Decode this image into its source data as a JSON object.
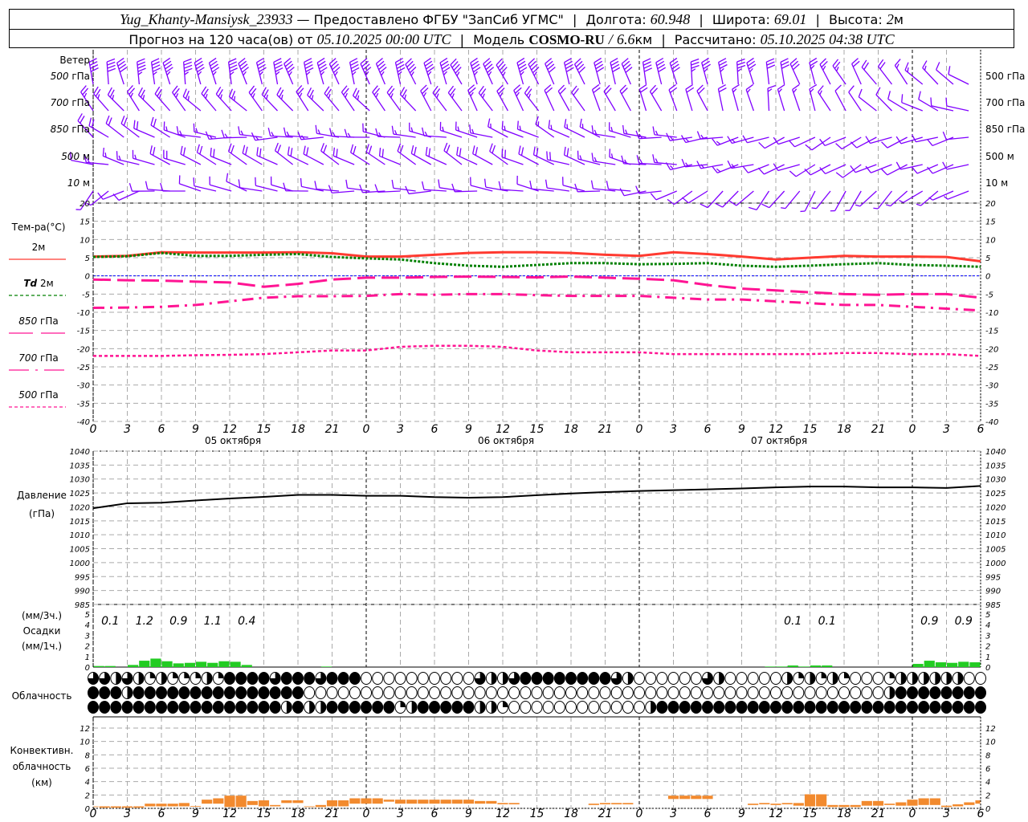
{
  "header": {
    "station": "Yug_Khanty-Mansiysk_23933",
    "dash": "—",
    "provider": "Предоставлено ФГБУ \"ЗапСиб УГМС\"",
    "lon_label": "Долгота:",
    "lon": "60.948",
    "lat_label": "Широта:",
    "lat": "69.01",
    "alt_label": "Высота:",
    "alt": "2",
    "alt_unit": "м",
    "forecast_label": "Прогноз на 120 часа(ов) от",
    "forecast_time": "05.10.2025 00:00 UTC",
    "model_label": "Модель",
    "model": "COSMO-RU",
    "slash": "/",
    "resolution": "6.6",
    "res_unit": "км",
    "calc_label": "Рассчитано:",
    "calc_time": "05.10.2025 04:38 UTC",
    "sep": "|"
  },
  "colors": {
    "wind": "#8000ff",
    "t2m": "#ff3a30",
    "td2m": "#008000",
    "t850": "#ff1493",
    "t700": "#ff1493",
    "t500": "#ff1493",
    "zero_line": "#0000ff",
    "pressure": "#000000",
    "precip": "#22cc22",
    "convective": "#f28a2e",
    "grid": "#aaaaaa"
  },
  "x_axis": {
    "hours": [
      0,
      3,
      6,
      9,
      12,
      15,
      18,
      21,
      0,
      3,
      6,
      9,
      12,
      15,
      18,
      21,
      0,
      3,
      6,
      9,
      12,
      15,
      18,
      21,
      0,
      3,
      6
    ],
    "dates": [
      "05 октября",
      "06 октября",
      "07 октября"
    ]
  },
  "chart_data": [
    {
      "type": "barbs",
      "panel": "wind",
      "title": "Ветер",
      "levels": [
        {
          "name": "500 гПа",
          "dir_deg": [
            350,
            350,
            345,
            345,
            340,
            340,
            335,
            340,
            345,
            350,
            350,
            330,
            320,
            300
          ],
          "speed_ms": [
            20,
            22,
            22,
            23,
            23,
            22,
            22,
            21,
            20,
            18,
            16,
            12,
            8,
            5
          ]
        },
        {
          "name": "700 гПа",
          "dir_deg": [
            320,
            320,
            315,
            320,
            320,
            325,
            330,
            330,
            335,
            340,
            350,
            330,
            300,
            280
          ],
          "speed_ms": [
            12,
            12,
            12,
            13,
            13,
            13,
            12,
            11,
            10,
            9,
            8,
            6,
            5,
            5
          ]
        },
        {
          "name": "850 гПа",
          "dir_deg": [
            310,
            300,
            270,
            270,
            275,
            280,
            290,
            300,
            280,
            260,
            250,
            240,
            250,
            260
          ],
          "speed_ms": [
            9,
            9,
            8,
            8,
            8,
            8,
            8,
            8,
            8,
            7,
            6,
            6,
            6,
            6
          ]
        },
        {
          "name": "500 м",
          "dir_deg": [
            280,
            290,
            300,
            300,
            300,
            300,
            300,
            290,
            280,
            260,
            250,
            240,
            250,
            250
          ],
          "speed_ms": [
            6,
            9,
            10,
            10,
            10,
            10,
            9,
            9,
            8,
            7,
            6,
            6,
            5,
            5
          ]
        },
        {
          "name": "10 м",
          "dir_deg": [
            220,
            270,
            290,
            280,
            270,
            270,
            280,
            280,
            270,
            230,
            220,
            210,
            230,
            250
          ],
          "speed_ms": [
            3,
            5,
            6,
            5,
            5,
            5,
            5,
            5,
            5,
            4,
            4,
            3,
            3,
            3
          ]
        }
      ],
      "x_step_hours": 6
    },
    {
      "type": "line",
      "panel": "temperature",
      "ylabel": "Тем-ра(°C)",
      "ylim": [
        -40,
        20
      ],
      "yticks": [
        20,
        15,
        10,
        5,
        0,
        -5,
        -10,
        -15,
        -20,
        -25,
        -30,
        -35,
        -40
      ],
      "x_step_hours": 3,
      "series": [
        {
          "name": "2м",
          "values": [
            5.3,
            5.5,
            6.5,
            6.4,
            6.4,
            6.4,
            6.5,
            6.2,
            5.3,
            5.3,
            5.8,
            6.3,
            6.5,
            6.5,
            6.3,
            5.8,
            5.5,
            6.5,
            6.0,
            5.3,
            4.5,
            5.0,
            5.5,
            5.3,
            5.3,
            5.2,
            4.0
          ]
        },
        {
          "name": "Td",
          "name2": "2м",
          "values": [
            5.2,
            5.4,
            6.3,
            5.5,
            5.5,
            5.8,
            6.0,
            5.2,
            4.8,
            4.5,
            3.5,
            2.8,
            2.5,
            3.0,
            3.5,
            3.5,
            3.2,
            3.3,
            3.5,
            2.8,
            2.5,
            2.8,
            3.2,
            3.5,
            3.0,
            2.8,
            2.5
          ]
        },
        {
          "name": "850",
          "name2": "гПа",
          "values": [
            -1,
            -1.2,
            -1.3,
            -1.6,
            -1.8,
            -3,
            -2.2,
            -1,
            -0.5,
            -0.5,
            -0.3,
            -0.2,
            -0.3,
            -0.4,
            -0.2,
            -0.5,
            -0.8,
            -1.2,
            -2.5,
            -3.5,
            -4,
            -4.5,
            -5,
            -5.2,
            -5,
            -5,
            -6
          ]
        },
        {
          "name": "700",
          "name2": "гПа",
          "values": [
            -8.8,
            -8.7,
            -8.5,
            -8,
            -7,
            -6,
            -5.6,
            -5.6,
            -5.5,
            -5.0,
            -5.2,
            -5.0,
            -5.0,
            -5.3,
            -5.5,
            -5.5,
            -5.5,
            -6.0,
            -6.5,
            -6.5,
            -7.0,
            -7.5,
            -8.0,
            -8.0,
            -8.5,
            -9.0,
            -9.5
          ]
        },
        {
          "name": "500",
          "name2": "гПа",
          "values": [
            -22,
            -22,
            -22,
            -21.8,
            -21.7,
            -21.5,
            -21,
            -20.5,
            -20.5,
            -19.5,
            -19.2,
            -19.2,
            -19.5,
            -20.5,
            -21,
            -21,
            -21,
            -21.5,
            -21.5,
            -21.5,
            -21.5,
            -21.5,
            -21.2,
            -21.2,
            -21.5,
            -21.5,
            -22
          ]
        }
      ]
    },
    {
      "type": "line",
      "panel": "pressure",
      "ylabel": "Давление",
      "yunit": "(гПа)",
      "ylim": [
        985,
        1040
      ],
      "yticks": [
        1040,
        1035,
        1030,
        1025,
        1020,
        1015,
        1010,
        1005,
        1000,
        995,
        990,
        985
      ],
      "x_step_hours": 3,
      "values": [
        1019.5,
        1021.3,
        1021.5,
        1022.3,
        1023,
        1023.6,
        1024.3,
        1024.3,
        1024,
        1024,
        1023.5,
        1023.3,
        1023.5,
        1024.2,
        1024.8,
        1025.3,
        1025.7,
        1026,
        1026.3,
        1026.6,
        1027,
        1027.3,
        1027.3,
        1027,
        1027,
        1026.8,
        1027.5
      ]
    },
    {
      "type": "bar",
      "panel": "precipitation",
      "ylabel": "Осадки",
      "yunit_top": "(мм/3ч.)",
      "yunit_bottom": "(мм/1ч.)",
      "ylim": [
        0,
        5
      ],
      "yticks": [
        5,
        4,
        3,
        2,
        1,
        0
      ],
      "x_step_hours": 1,
      "hourly_mm": [
        0.1,
        0.1,
        0,
        0.2,
        0.6,
        0.8,
        0.55,
        0.35,
        0.4,
        0.5,
        0.4,
        0.55,
        0.5,
        0.2,
        0,
        0,
        0,
        0,
        0,
        0,
        0.05,
        0,
        0,
        0,
        0,
        0,
        0,
        0,
        0,
        0,
        0,
        0,
        0,
        0,
        0,
        0,
        0,
        0,
        0,
        0,
        0,
        0,
        0,
        0,
        0,
        0,
        0,
        0,
        0,
        0,
        0,
        0,
        0,
        0,
        0,
        0,
        0,
        0,
        0,
        0.05,
        0.05,
        0.15,
        0.05,
        0.15,
        0.15,
        0,
        0,
        0,
        0,
        0,
        0,
        0,
        0.3,
        0.6,
        0.45,
        0.4,
        0.5,
        0.45
      ],
      "three_hour_labels": [
        {
          "hour": 1.5,
          "text": "0.1"
        },
        {
          "hour": 4.5,
          "text": "1.2"
        },
        {
          "hour": 7.5,
          "text": "0.9"
        },
        {
          "hour": 10.5,
          "text": "1.1"
        },
        {
          "hour": 13.5,
          "text": "0.4"
        },
        {
          "hour": 61.5,
          "text": "0.1"
        },
        {
          "hour": 64.5,
          "text": "0.1"
        },
        {
          "hour": 73.5,
          "text": "0.9"
        },
        {
          "hour": 76.5,
          "text": "0.9"
        }
      ]
    },
    {
      "type": "symbols",
      "panel": "cloudiness",
      "label": "Облачность",
      "encoding": "quarters filled 0-4 per hour",
      "rows": [
        "3323212111214444344434440000000000322344444444320000003200000212121000122222200",
        "4442444444444444444000000000000000000000000000000000000000000000000000244444444",
        "4444444444444444424224444441244444221000000000000244444444444444444444444444444"
      ]
    },
    {
      "type": "bar",
      "panel": "convective",
      "ylabel": "Конвективн.",
      "ylabel2": "облачность",
      "yunit": "(км)",
      "ylim": [
        0,
        13.7
      ],
      "yticks": [
        12,
        10,
        8,
        6,
        4,
        2,
        0
      ],
      "x_step_hours": 1,
      "base_top_km": [
        [
          0.2,
          0.3
        ],
        [
          0.1,
          0.3
        ],
        [
          0.1,
          0.3
        ],
        [
          0.1,
          0.3
        ],
        [
          0.1,
          0.3
        ],
        [
          0.3,
          0.7
        ],
        [
          0.3,
          0.7
        ],
        [
          0.3,
          0.7
        ],
        [
          0.3,
          0.8
        ],
        [
          0.25,
          0.35
        ],
        [
          0.7,
          1.3
        ],
        [
          0.7,
          1.5
        ],
        [
          0.2,
          1.9
        ],
        [
          0.2,
          1.9
        ],
        [
          0.5,
          1.1
        ],
        [
          0.3,
          1.2
        ],
        [
          0.3,
          0.5
        ],
        [
          0.8,
          1.2
        ],
        [
          0.8,
          1.2
        ],
        [
          0.2,
          0.3
        ],
        [
          0.2,
          0.5
        ],
        [
          0.3,
          1.2
        ],
        [
          0.3,
          1.2
        ],
        [
          0.7,
          1.5
        ],
        [
          0.7,
          1.5
        ],
        [
          0.7,
          1.5
        ],
        [
          1.0,
          1.3
        ],
        [
          0.7,
          1.3
        ],
        [
          0.7,
          1.3
        ],
        [
          0.7,
          1.3
        ],
        [
          0.7,
          1.3
        ],
        [
          0.7,
          1.3
        ],
        [
          0.7,
          1.3
        ],
        [
          0.7,
          1.3
        ],
        [
          0.7,
          1.1
        ],
        [
          0.7,
          1.1
        ],
        [
          0.6,
          0.8
        ],
        [
          0.6,
          0.8
        ],
        null,
        null,
        null,
        null,
        null,
        null,
        [
          0.5,
          0.7
        ],
        [
          0.6,
          0.8
        ],
        [
          0.6,
          0.8
        ],
        [
          0.6,
          0.8
        ],
        null,
        null,
        null,
        [
          1.4,
          1.9
        ],
        [
          1.4,
          1.9
        ],
        [
          1.4,
          1.9
        ],
        [
          1.4,
          1.9
        ],
        null,
        null,
        null,
        [
          0.5,
          0.7
        ],
        [
          0.6,
          0.8
        ],
        [
          0.5,
          0.7
        ],
        [
          0.6,
          0.8
        ],
        [
          0.4,
          0.8
        ],
        [
          0.3,
          2.1
        ],
        [
          0.3,
          2.1
        ],
        [
          0.2,
          0.5
        ],
        [
          0.2,
          0.5
        ],
        [
          0.2,
          0.5
        ],
        [
          0.4,
          1.1
        ],
        [
          0.4,
          1.1
        ],
        [
          0.5,
          0.7
        ],
        [
          0.4,
          0.9
        ],
        [
          0.4,
          1.3
        ],
        [
          0.5,
          1.5
        ],
        [
          0.5,
          1.5
        ],
        [
          0.2,
          0.4
        ],
        [
          0.3,
          0.6
        ],
        [
          0.5,
          0.9
        ],
        [
          0.7,
          1.2
        ]
      ]
    }
  ]
}
